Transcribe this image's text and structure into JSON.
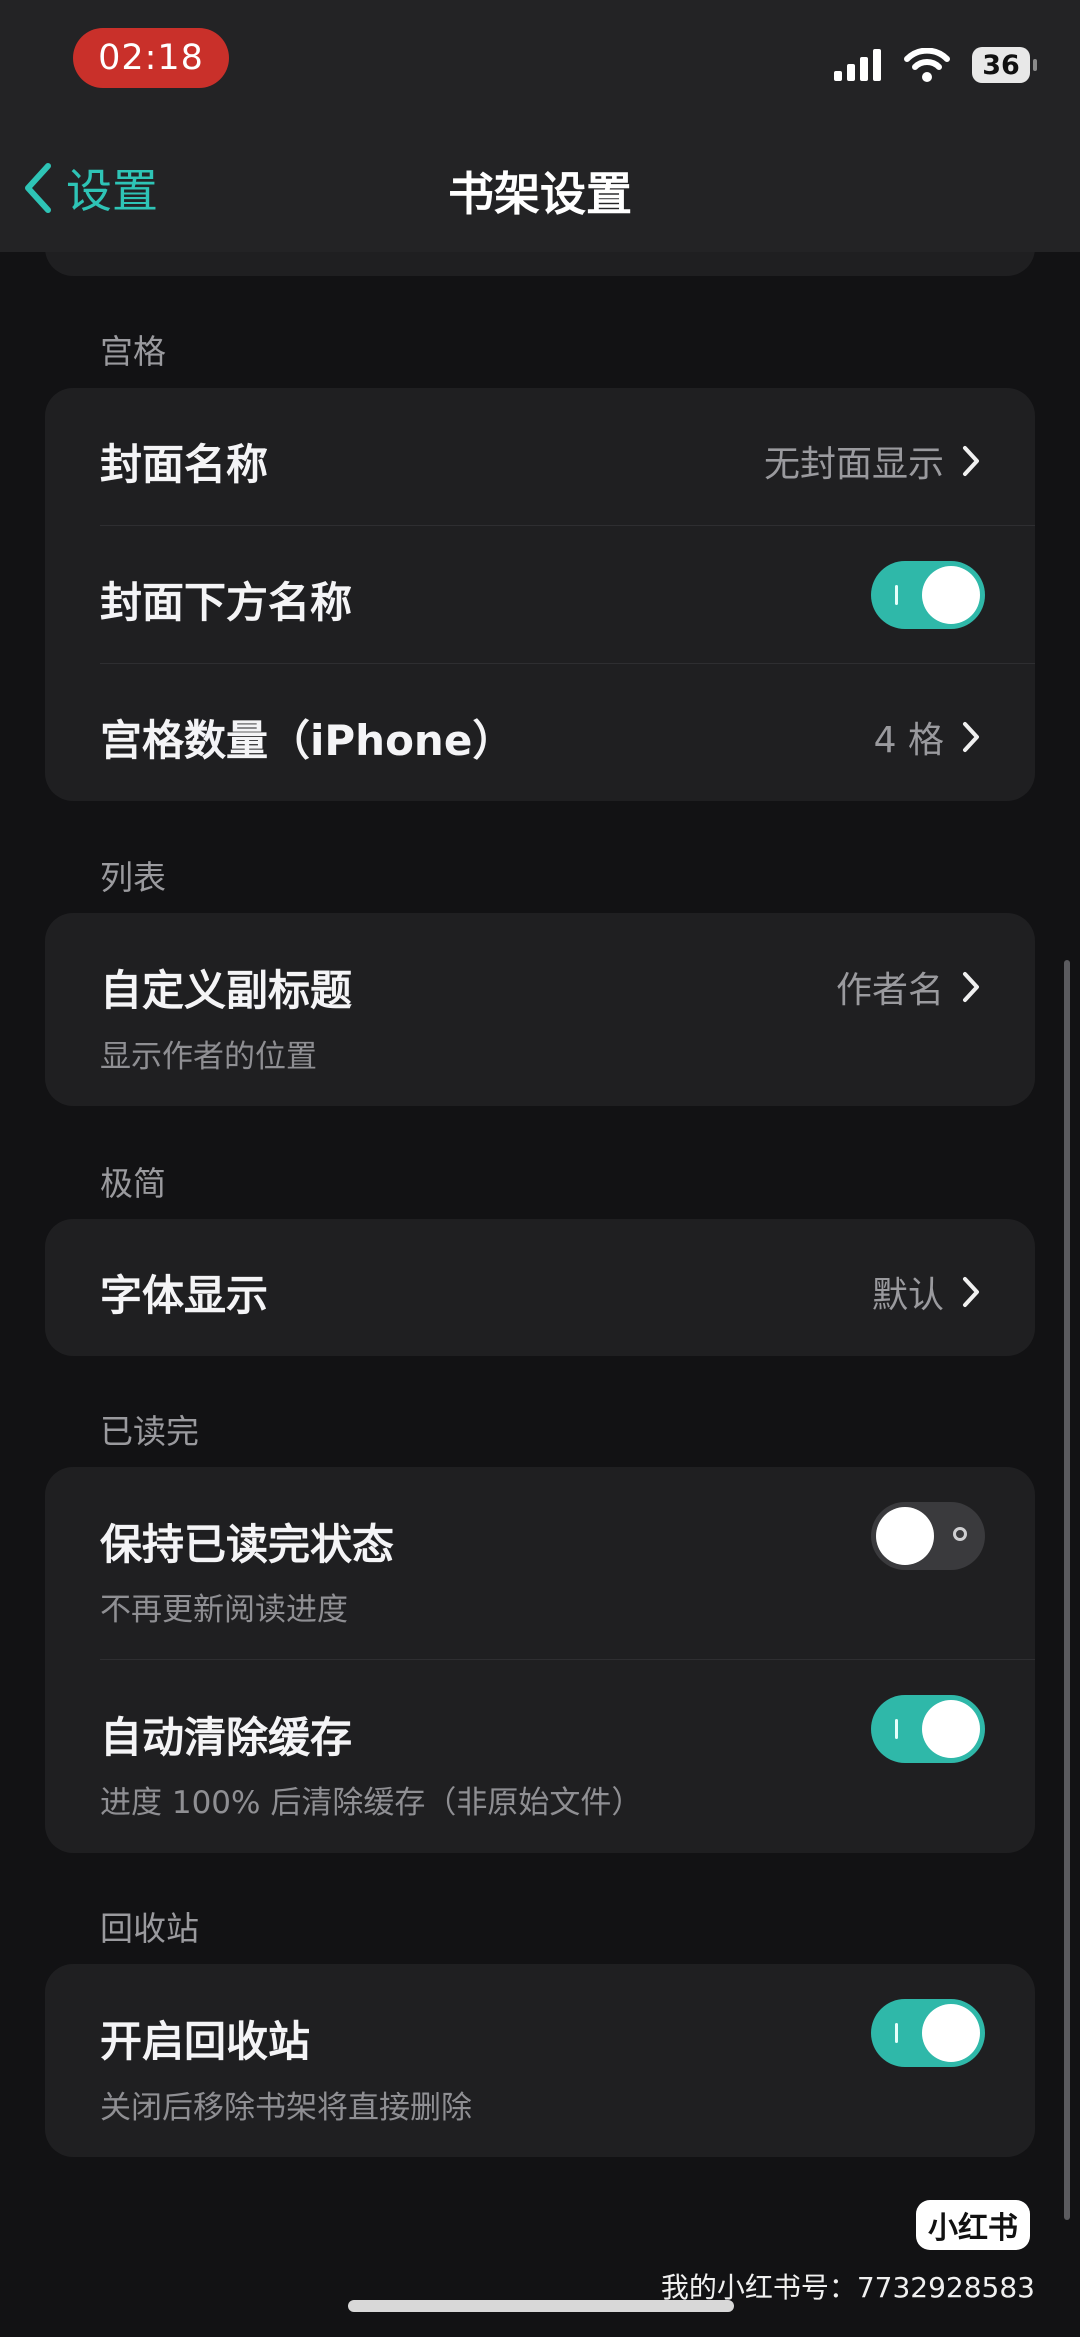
{
  "status_bar": {
    "time": "02:18",
    "battery": "36"
  },
  "nav": {
    "back_label": "设置",
    "title": "书架设置"
  },
  "sections": {
    "grid": {
      "label": "宫格",
      "cover_name": {
        "title": "封面名称",
        "value": "无封面显示"
      },
      "cover_below_name": {
        "title": "封面下方名称",
        "enabled": true
      },
      "grid_count": {
        "title": "宫格数量（iPhone）",
        "value": "4 格"
      }
    },
    "list": {
      "label": "列表",
      "custom_subtitle": {
        "title": "自定义副标题",
        "subtitle": "显示作者的位置",
        "value": "作者名"
      }
    },
    "minimal": {
      "label": "极简",
      "font_display": {
        "title": "字体显示",
        "value": "默认"
      }
    },
    "finished": {
      "label": "已读完",
      "keep_status": {
        "title": "保持已读完状态",
        "subtitle": "不再更新阅读进度",
        "enabled": false
      },
      "auto_clear_cache": {
        "title": "自动清除缓存",
        "subtitle": "进度 100% 后清除缓存（非原始文件）",
        "enabled": true
      }
    },
    "recycle": {
      "label": "回收站",
      "enable_recycle": {
        "title": "开启回收站",
        "subtitle": "关闭后移除书架将直接删除",
        "enabled": true
      }
    }
  },
  "watermark": {
    "logo": "小红书",
    "text": "我的小红书号：7732928583"
  },
  "colors": {
    "accent": "#2fb8a9",
    "background": "#121214",
    "card": "#1f1f21",
    "status_pill": "#c9302a"
  }
}
